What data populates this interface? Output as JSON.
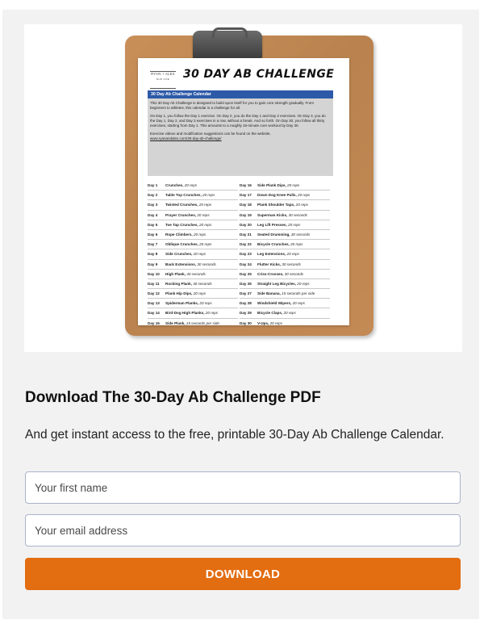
{
  "hero": {
    "brand_name": "RYAN + ALEX",
    "brand_tagline": "DUO LIFE",
    "doc_title": "30 DAY AB CHALLENGE",
    "banner": "30 Day Ab Challenge Calendar",
    "intro": [
      "This 30 Day Ab Challenge is designed to build upon itself for you to gain core strength gradually. From beginners to athletes, this calendar is a challenge for all.",
      "On Day 1, you follow the Day 1 exercise. On Day 2, you do the Day 1 and Day 2 exercises. On Day 3, you do the Day 1, Day 2, and Day 3 exercises in a row, without a break. And so forth. On Day 30, you follow all thirty exercises, starting from Day 1. This amounts to a roughly 15-minute core workout by Day 30.",
      "Exercise videos and modification suggestions can be found on the website,"
    ],
    "intro_link": "www.ryanandalex.com/30-day-ab-challenge/",
    "days_left": [
      {
        "day": "Day 1",
        "exercise": "Crunches,",
        "reps": "20 reps"
      },
      {
        "day": "Day 2",
        "exercise": "Table Top Crunches,",
        "reps": "20 reps"
      },
      {
        "day": "Day 3",
        "exercise": "Twisted Crunches,",
        "reps": "20 reps"
      },
      {
        "day": "Day 4",
        "exercise": "Prayer Crunches,",
        "reps": "20 reps"
      },
      {
        "day": "Day 5",
        "exercise": "Toe Tap Crunches,",
        "reps": "20 reps"
      },
      {
        "day": "Day 6",
        "exercise": "Rope Climbers,",
        "reps": "20 reps"
      },
      {
        "day": "Day 7",
        "exercise": "Oblique Crunches,",
        "reps": "20 reps"
      },
      {
        "day": "Day 8",
        "exercise": "Side Crunches,",
        "reps": "20 reps"
      },
      {
        "day": "Day 9",
        "exercise": "Back Extensions,",
        "reps": "30 seconds"
      },
      {
        "day": "Day 10",
        "exercise": "High Plank,",
        "reps": "30 seconds"
      },
      {
        "day": "Day 11",
        "exercise": "Rocking Plank,",
        "reps": "30 seconds"
      },
      {
        "day": "Day 12",
        "exercise": "Plank Hip Dips,",
        "reps": "20 reps"
      },
      {
        "day": "Day 13",
        "exercise": "Spiderman Planks,",
        "reps": "20 reps"
      },
      {
        "day": "Day 14",
        "exercise": "Bird-Dog High Planks,",
        "reps": "20 reps"
      },
      {
        "day": "Day 15",
        "exercise": "Side Plank,",
        "reps": "15 seconds per side"
      },
      {
        "day": "Day 31",
        "exercise": "BONUS: Pike Ups,",
        "reps": "20 reps"
      }
    ],
    "days_right": [
      {
        "day": "Day 16",
        "exercise": "Side Plank Dips,",
        "reps": "20 reps"
      },
      {
        "day": "Day 17",
        "exercise": "Down Dog Knee Pulls,",
        "reps": "20 reps"
      },
      {
        "day": "Day 18",
        "exercise": "Plank Shoulder Taps,",
        "reps": "20 reps"
      },
      {
        "day": "Day 19",
        "exercise": "Superman Kicks,",
        "reps": "30 seconds"
      },
      {
        "day": "Day 20",
        "exercise": "Leg Lift Presses,",
        "reps": "20 reps"
      },
      {
        "day": "Day 21",
        "exercise": "Seated Drumming,",
        "reps": "30 seconds"
      },
      {
        "day": "Day 22",
        "exercise": "Bicycle Crunches,",
        "reps": "20 reps"
      },
      {
        "day": "Day 23",
        "exercise": "Leg Extensions,",
        "reps": "20 reps"
      },
      {
        "day": "Day 24",
        "exercise": "Flutter Kicks,",
        "reps": "30 seconds"
      },
      {
        "day": "Day 25",
        "exercise": "Criss-Crosses,",
        "reps": "30 seconds"
      },
      {
        "day": "Day 26",
        "exercise": "Straight Leg Bicycles,",
        "reps": "20 reps"
      },
      {
        "day": "Day 27",
        "exercise": "Side Banana,",
        "reps": "15 seconds per side"
      },
      {
        "day": "Day 28",
        "exercise": "Windshield Wipers,",
        "reps": "20 reps"
      },
      {
        "day": "Day 29",
        "exercise": "Bicycle Claps,",
        "reps": "20 reps"
      },
      {
        "day": "Day 30",
        "exercise": "V-Ups,",
        "reps": "20 reps"
      }
    ]
  },
  "form": {
    "heading": "Download The 30-Day Ab Challenge PDF",
    "subtext": "And get instant access to the free, printable 30-Day Ab Challenge Calendar.",
    "first_name_placeholder": "Your first name",
    "email_placeholder": "Your email address",
    "button_label": "DOWNLOAD"
  },
  "colors": {
    "button": "#e36d11",
    "banner": "#2d5aa8",
    "card_background": "#f2f2f2"
  }
}
